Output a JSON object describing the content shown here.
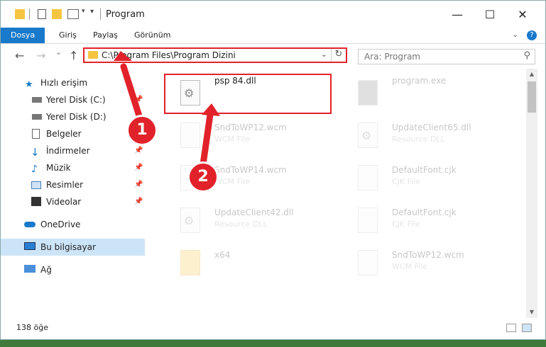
{
  "window": {
    "title": "Program",
    "controls": {
      "minimize": "—",
      "maximize": "☐",
      "close": "✕"
    }
  },
  "ribbon": {
    "tabs": [
      "Dosya",
      "Giriş",
      "Paylaş",
      "Görünüm"
    ],
    "active_tab": "Dosya",
    "help_glyph": "?"
  },
  "nav": {
    "back": "←",
    "forward": "→",
    "up": "↑",
    "recent": "⌄",
    "address": "C:\\Program Files\\Program Dizini",
    "search_placeholder": "Ara: Program"
  },
  "sidebar": {
    "items": [
      {
        "label": "Hızlı erişim",
        "icon": "star-icon"
      },
      {
        "label": "Yerel Disk (C:)",
        "icon": "drive-icon",
        "pinned": true
      },
      {
        "label": "Yerel Disk (D:)",
        "icon": "drive-icon"
      },
      {
        "label": "Belgeler",
        "icon": "documents-icon",
        "pinned": true
      },
      {
        "label": "İndirmeler",
        "icon": "downloads-icon",
        "pinned": true
      },
      {
        "label": "Müzik",
        "icon": "music-icon",
        "pinned": true
      },
      {
        "label": "Resimler",
        "icon": "pictures-icon",
        "pinned": true
      },
      {
        "label": "Videolar",
        "icon": "videos-icon",
        "pinned": true
      },
      {
        "label": "OneDrive",
        "icon": "onedrive-icon"
      },
      {
        "label": "Bu bilgisayar",
        "icon": "computer-icon",
        "selected": true
      },
      {
        "label": "Ağ",
        "icon": "network-icon"
      }
    ]
  },
  "files": [
    {
      "name": "psp 84.dll",
      "type": "",
      "icon": "dll-gear-icon",
      "highlighted": true
    },
    {
      "name": "program.exe",
      "type": "",
      "icon": "exe-icon"
    },
    {
      "name": "SndToWP12.wcm",
      "type": "WCM File",
      "icon": "file-icon"
    },
    {
      "name": "UpdateClient65.dll",
      "type": "Resource DLL",
      "icon": "dll-gear-icon"
    },
    {
      "name": "SndToWP14.wcm",
      "type": "WCM File",
      "icon": "file-icon"
    },
    {
      "name": "DefaultFont.cjk",
      "type": "CJK File",
      "icon": "file-icon"
    },
    {
      "name": "UpdateClient42.dll",
      "type": "Resource DLL",
      "icon": "dll-gear-icon"
    },
    {
      "name": "DefaultFont.cjk",
      "type": "CJK File",
      "icon": "file-icon"
    },
    {
      "name": "x64",
      "type": "",
      "icon": "folder-icon"
    },
    {
      "name": "SndToWP12.wcm",
      "type": "WCM File",
      "icon": "file-icon"
    }
  ],
  "status": {
    "count": "138 öğe"
  },
  "annotations": {
    "step1": "1",
    "step2": "2",
    "color": "#e2222a"
  }
}
